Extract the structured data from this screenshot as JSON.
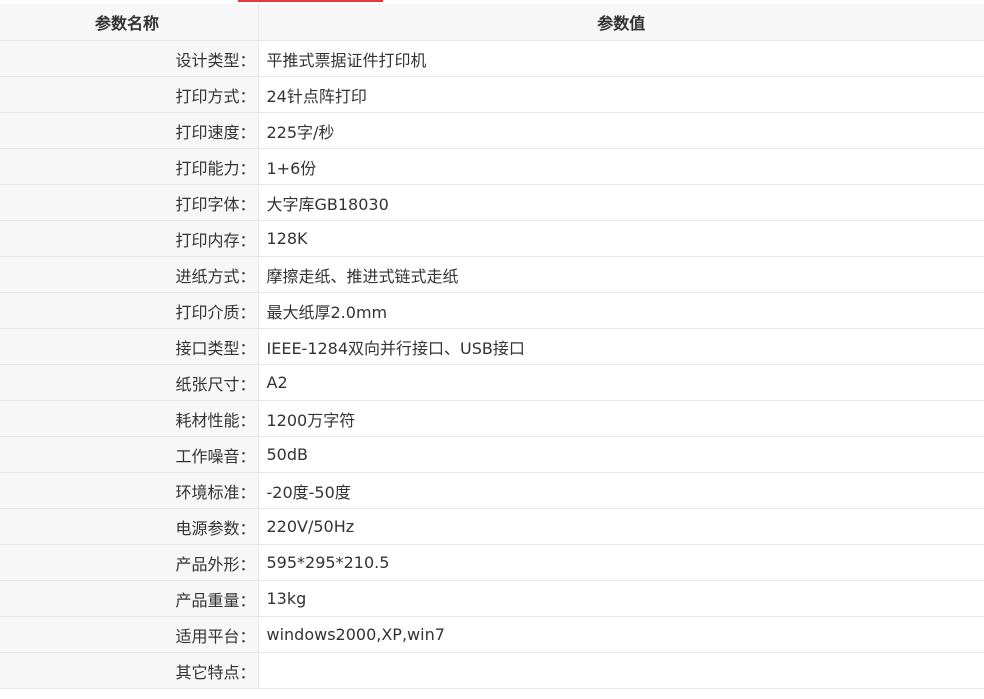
{
  "table": {
    "header": {
      "name_col": "参数名称",
      "value_col": "参数值"
    },
    "rows": [
      {
        "name": "设计类型：",
        "value": "平推式票据证件打印机"
      },
      {
        "name": "打印方式：",
        "value": "24针点阵打印"
      },
      {
        "name": "打印速度：",
        "value": "225字/秒"
      },
      {
        "name": "打印能力：",
        "value": "1+6份"
      },
      {
        "name": "打印字体：",
        "value": "大字库GB18030"
      },
      {
        "name": "打印内存：",
        "value": "128K"
      },
      {
        "name": "进纸方式：",
        "value": "摩擦走纸、推进式链式走纸"
      },
      {
        "name": "打印介质：",
        "value": "最大纸厚2.0mm"
      },
      {
        "name": "接口类型：",
        "value": "IEEE-1284双向并行接口、USB接口"
      },
      {
        "name": "纸张尺寸：",
        "value": "A2"
      },
      {
        "name": "耗材性能：",
        "value": "1200万字符"
      },
      {
        "name": "工作噪音：",
        "value": "50dB"
      },
      {
        "name": "环境标准：",
        "value": "-20度-50度"
      },
      {
        "name": "电源参数：",
        "value": "220V/50Hz"
      },
      {
        "name": "产品外形：",
        "value": "595*295*210.5"
      },
      {
        "name": "产品重量：",
        "value": "13kg"
      },
      {
        "name": "适用平台：",
        "value": "windows2000,XP,win7"
      },
      {
        "name": "其它特点：",
        "value": ""
      }
    ]
  },
  "colors": {
    "accent": "#e4393c",
    "label_bg": "#f7f7f7",
    "border": "#e6e6e6",
    "text": "#333333"
  }
}
